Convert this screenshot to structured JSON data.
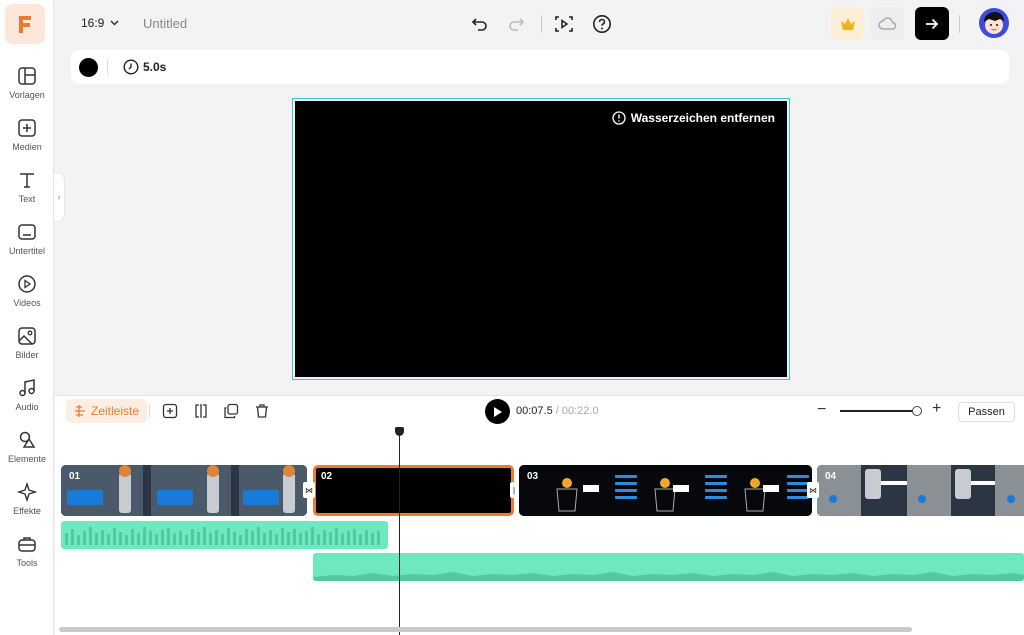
{
  "sidebar": {
    "items": [
      {
        "label": "Vorlagen",
        "icon": "templates-icon"
      },
      {
        "label": "Medien",
        "icon": "media-upload-icon"
      },
      {
        "label": "Text",
        "icon": "text-icon"
      },
      {
        "label": "Untertitel",
        "icon": "subtitles-icon"
      },
      {
        "label": "Videos",
        "icon": "video-icon"
      },
      {
        "label": "Bilder",
        "icon": "image-icon"
      },
      {
        "label": "Audio",
        "icon": "music-note-icon"
      },
      {
        "label": "Elemente",
        "icon": "shapes-icon"
      },
      {
        "label": "Effekte",
        "icon": "sparkle-icon"
      },
      {
        "label": "Tools",
        "icon": "toolbox-icon"
      }
    ]
  },
  "header": {
    "aspect_ratio": "16:9",
    "project_title": "Untitled"
  },
  "properties": {
    "duration": "5.0s",
    "background_color": "#000000"
  },
  "canvas": {
    "watermark_label": "Wasserzeichen entfernen"
  },
  "timeline": {
    "tab_label": "Zeitleiste",
    "current_time": "00:07.5",
    "separator": " / ",
    "total_time": "00:22.0",
    "fit_label": "Passen",
    "clips": [
      "01",
      "02",
      "03",
      "04"
    ]
  },
  "colors": {
    "accent": "#f07a2c",
    "selection": "#35c6dd",
    "audio_track": "#6fe8bf"
  }
}
